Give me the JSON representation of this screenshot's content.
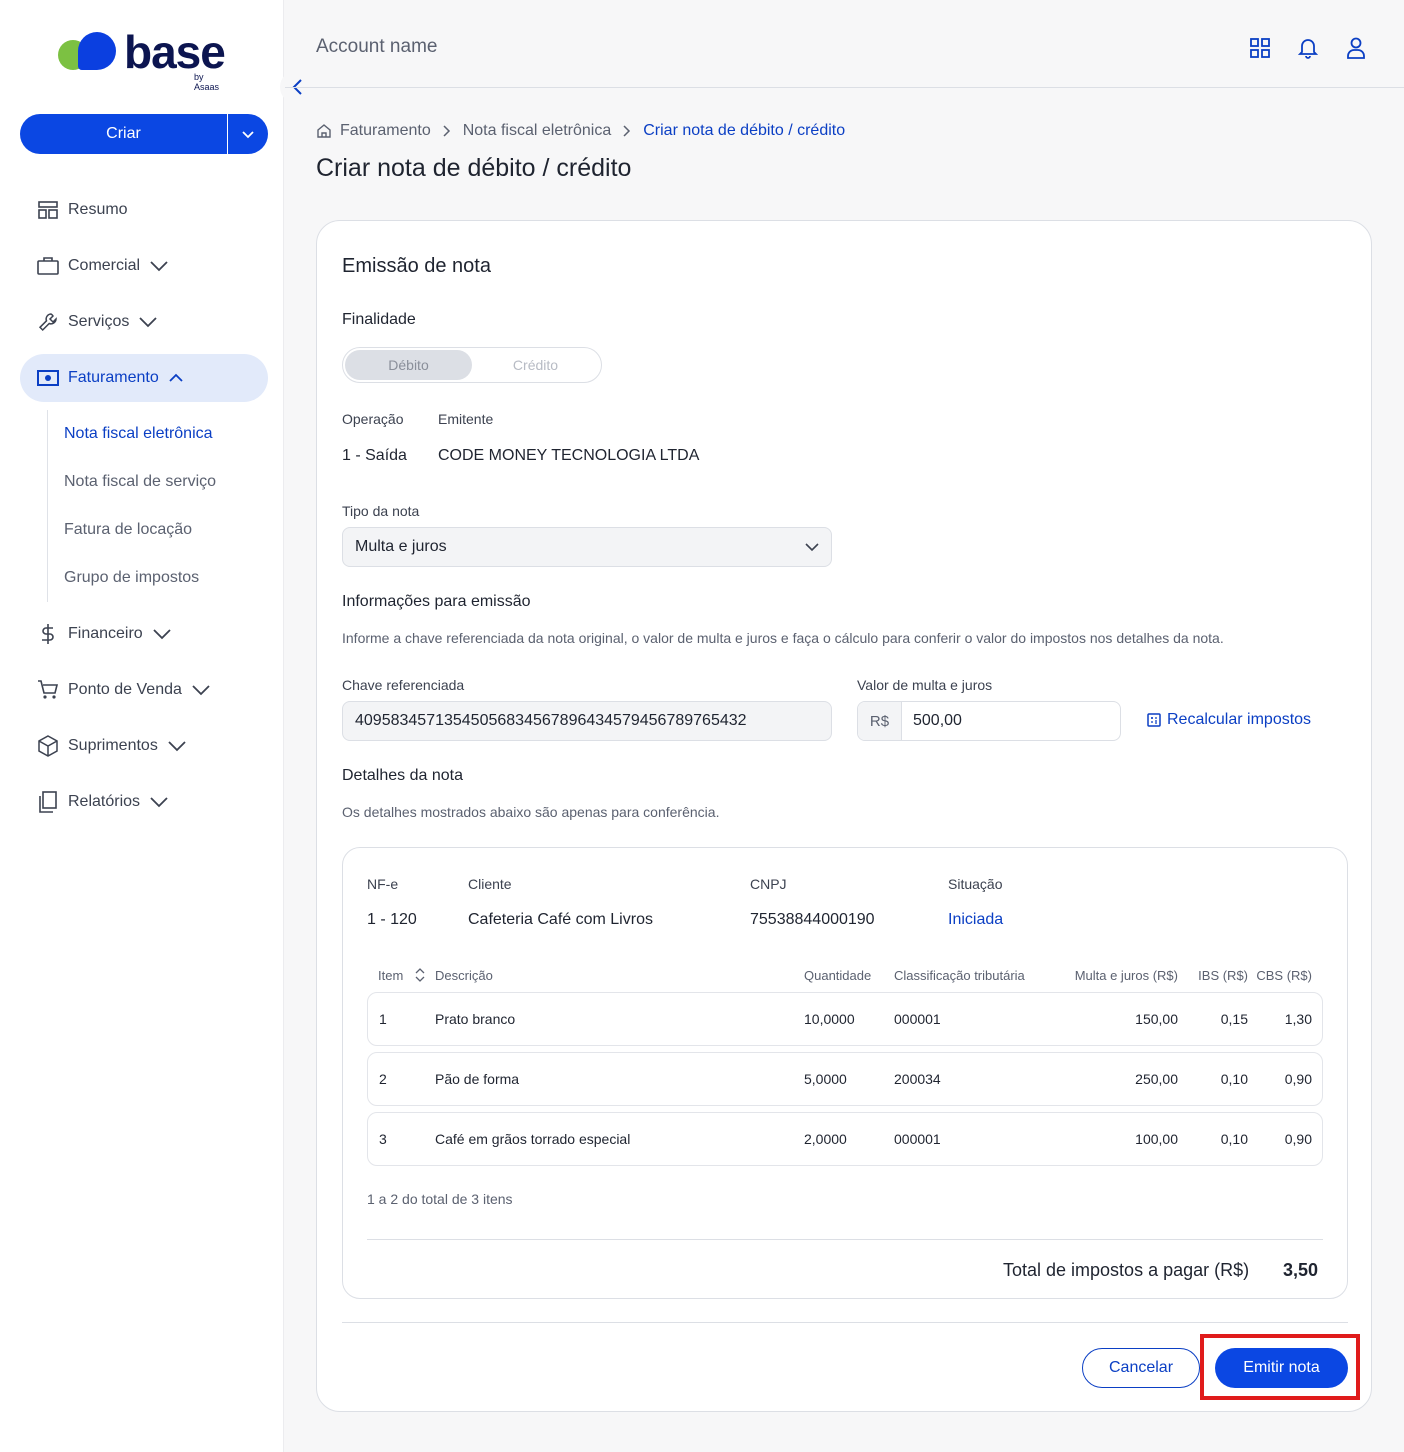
{
  "brand": {
    "name": "base",
    "sub": "by Asaas",
    "colors": {
      "green": "#7cc142",
      "blue": "#0b3fe0",
      "navy": "#0c1550"
    }
  },
  "create_button": {
    "label": "Criar"
  },
  "sidebar": {
    "items": [
      {
        "label": "Resumo",
        "icon": "dashboard-icon"
      },
      {
        "label": "Comercial",
        "icon": "briefcase-icon"
      },
      {
        "label": "Serviços",
        "icon": "wrench-icon"
      },
      {
        "label": "Faturamento",
        "icon": "banknote-icon"
      },
      {
        "label": "Financeiro",
        "icon": "dollar-icon"
      },
      {
        "label": "Ponto de Venda",
        "icon": "cart-icon"
      },
      {
        "label": "Suprimentos",
        "icon": "box-icon"
      },
      {
        "label": "Relatórios",
        "icon": "documents-icon"
      }
    ],
    "sub_items": [
      "Nota fiscal eletrônica",
      "Nota fiscal de serviço",
      "Fatura de locação",
      "Grupo de impostos"
    ]
  },
  "header": {
    "account": "Account name"
  },
  "breadcrumb": [
    "Faturamento",
    "Nota fiscal eletrônica",
    "Criar nota de débito / crédito"
  ],
  "page_title": "Criar nota de débito / crédito",
  "form": {
    "card_title": "Emissão de nota",
    "finalidade_label": "Finalidade",
    "toggle": [
      "Débito",
      "Crédito"
    ],
    "operacao_label": "Operação",
    "operacao_value": "1 - Saída",
    "emitente_label": "Emitente",
    "emitente_value": "CODE MONEY TECNOLOGIA LTDA",
    "tipo_label": "Tipo da nota",
    "tipo_value": "Multa e juros",
    "info_title": "Informações para emissão",
    "info_help": "Informe a chave referenciada da nota original, o valor de multa e juros e faça o cálculo para conferir o valor do impostos nos detalhes da nota.",
    "chave_label": "Chave referenciada",
    "chave_value": "40958345713545056834567896434579456789765432",
    "valor_label": "Valor de multa e juros",
    "valor_prefix": "R$",
    "valor_value": "500,00",
    "recalc_label": "Recalcular impostos",
    "detalhes_title": "Detalhes da nota",
    "detalhes_help": "Os detalhes mostrados abaixo são apenas para conferência."
  },
  "details": {
    "nfe_label": "NF-e",
    "nfe_value": "1 - 120",
    "cliente_label": "Cliente",
    "cliente_value": "Cafeteria Café com Livros",
    "cnpj_label": "CNPJ",
    "cnpj_value": "75538844000190",
    "situacao_label": "Situação",
    "situacao_value": "Iniciada",
    "columns": [
      "Item",
      "Descrição",
      "Quantidade",
      "Classificação tributária",
      "Multa e juros (R$)",
      "IBS (R$)",
      "CBS (R$)"
    ],
    "rows": [
      {
        "item": "1",
        "desc": "Prato branco",
        "qtd": "10,0000",
        "class": "000001",
        "multa": "150,00",
        "ibs": "0,15",
        "cbs": "1,30"
      },
      {
        "item": "2",
        "desc": "Pão de forma",
        "qtd": "5,0000",
        "class": "200034",
        "multa": "250,00",
        "ibs": "0,10",
        "cbs": "0,90"
      },
      {
        "item": "3",
        "desc": "Café em grãos torrado especial",
        "qtd": "2,0000",
        "class": "000001",
        "multa": "100,00",
        "ibs": "0,10",
        "cbs": "0,90"
      }
    ],
    "pagination": "1 a 2 do total de 3 itens",
    "total_label": "Total de impostos a pagar (R$)",
    "total_value": "3,50"
  },
  "actions": {
    "cancel": "Cancelar",
    "submit": "Emitir nota"
  }
}
